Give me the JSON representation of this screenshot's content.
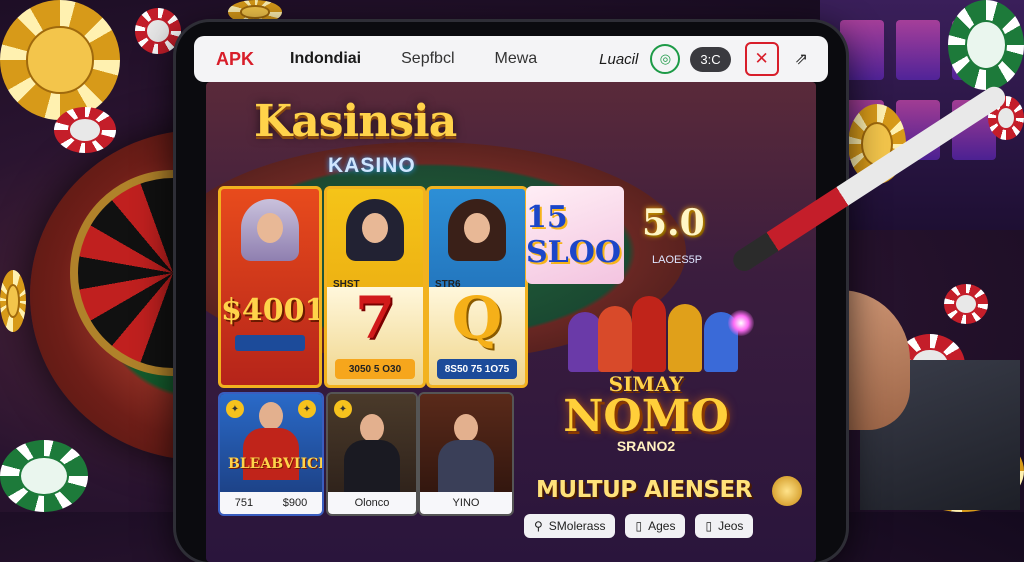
{
  "topbar": {
    "brand": "APK",
    "nav": [
      "Indondiai",
      "Sepfbcl",
      "Mewa"
    ],
    "lang": "Luacil",
    "pill": "3:C",
    "green_icon": "globe-icon",
    "close_icon": "close-icon",
    "share_icon": "share-icon"
  },
  "logo": {
    "title": "Kasinsia",
    "subtitle": "KASINO"
  },
  "cards": [
    {
      "top_tag": "",
      "value": "$4001",
      "badge": "",
      "button": "",
      "accent": "#e84b1c"
    },
    {
      "top_tag": "SHST",
      "glyph": "7",
      "button": "3050 5 O30",
      "accent": "#f2b21f"
    },
    {
      "top_tag": "STR6",
      "glyph": "Q",
      "button": "8S50 75 1O75",
      "accent": "#2d8fd6"
    }
  ],
  "promo": {
    "text": "15 SLOO"
  },
  "big_number": {
    "value": "5.0",
    "sub": "LAOES5P"
  },
  "feature": {
    "line1": "SIMAY",
    "line2": "NOMO",
    "line3": "SRANO2"
  },
  "tagline": "MULTUP AIENSER",
  "bottom_tabs": [
    {
      "icon": "search-icon",
      "label": "SMolerass"
    },
    {
      "icon": "phone-icon",
      "label": "Ages"
    },
    {
      "icon": "phone-icon",
      "label": "Jeos"
    }
  ],
  "row2": {
    "card1": {
      "banner": "BLEABVIICH",
      "labels": [
        "751",
        "$900"
      ]
    },
    "card2": {
      "label": "Olonco"
    },
    "card3": {
      "label": "YINO"
    }
  },
  "colors": {
    "accent_red": "#d81e2a",
    "gold": "#ffd34a",
    "green": "#1d9a47"
  }
}
